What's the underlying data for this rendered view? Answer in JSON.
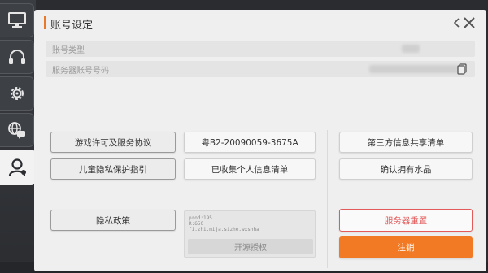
{
  "sidebar": {
    "tabs": [
      {
        "name": "display",
        "icon": "monitor-icon"
      },
      {
        "name": "audio",
        "icon": "headphones-icon"
      },
      {
        "name": "settings",
        "icon": "gear-icon"
      },
      {
        "name": "network",
        "icon": "globe-chat-icon"
      },
      {
        "name": "account",
        "icon": "user-icon",
        "active": true
      }
    ]
  },
  "panel": {
    "title": "账号设定",
    "accent_color": "#e8782a"
  },
  "account_info": {
    "type_label": "账号类型",
    "server_id_label": "服务器账号号码"
  },
  "buttons": {
    "license_agreement": "游戏许可及服务协议",
    "icp_number": "粤B2-20090059-3675A",
    "third_party_list": "第三方信息共享清单",
    "child_privacy": "儿童隐私保护指引",
    "personal_info_list": "已收集个人信息清单",
    "confirm_crystal": "确认拥有水晶",
    "privacy_policy": "隐私政策",
    "open_source": "开源授权",
    "server_reset": "服务器重置",
    "logout": "注销"
  },
  "license_box": {
    "text": "prod:195\nR:650\nfi.zhi.mija.sizhe.wxshha"
  },
  "colors": {
    "reset_border": "#e25a5a",
    "logout_bg": "#f27a24"
  }
}
